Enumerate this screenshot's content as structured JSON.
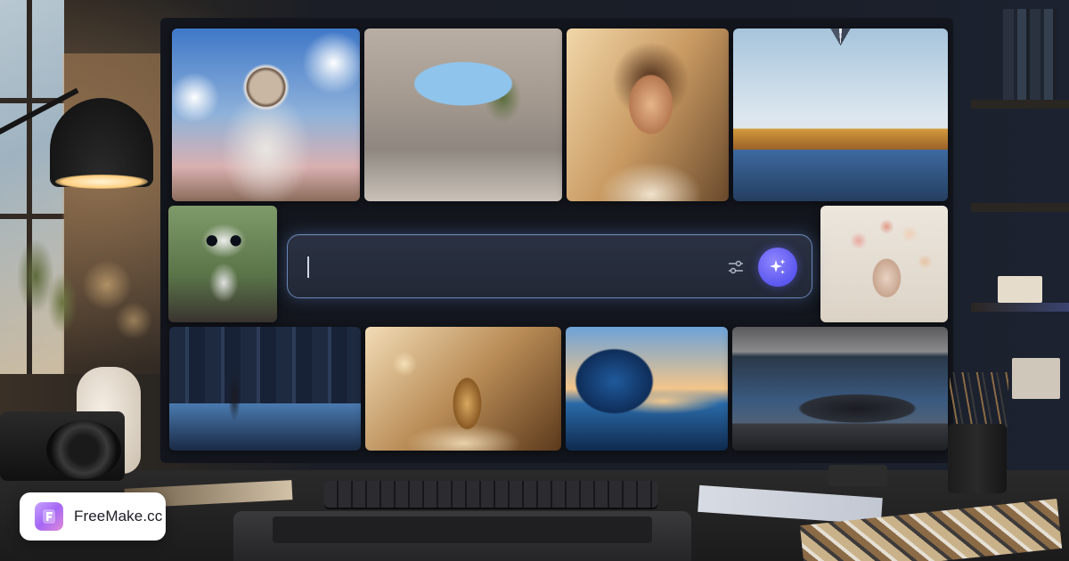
{
  "brand": {
    "name": "FreeMake.cc",
    "logo_icon": "brand-f-logo",
    "logo_color": "#a467f5"
  },
  "prompt": {
    "value": "",
    "placeholder": "",
    "settings_icon": "sliders-icon",
    "generate_icon": "sparkles-icon",
    "accent": "#5b57f0",
    "border_color": "#6a86b8"
  },
  "gallery": {
    "tiles": [
      {
        "id": "astronaut-flowers"
      },
      {
        "id": "concrete-architecture"
      },
      {
        "id": "woman-portrait"
      },
      {
        "id": "mountain-lake"
      },
      {
        "id": "cute-robot"
      },
      {
        "id": "floral-woman"
      },
      {
        "id": "neon-city-street"
      },
      {
        "id": "perfume-bottle"
      },
      {
        "id": "ocean-wave"
      },
      {
        "id": "sports-car-garage"
      }
    ]
  }
}
